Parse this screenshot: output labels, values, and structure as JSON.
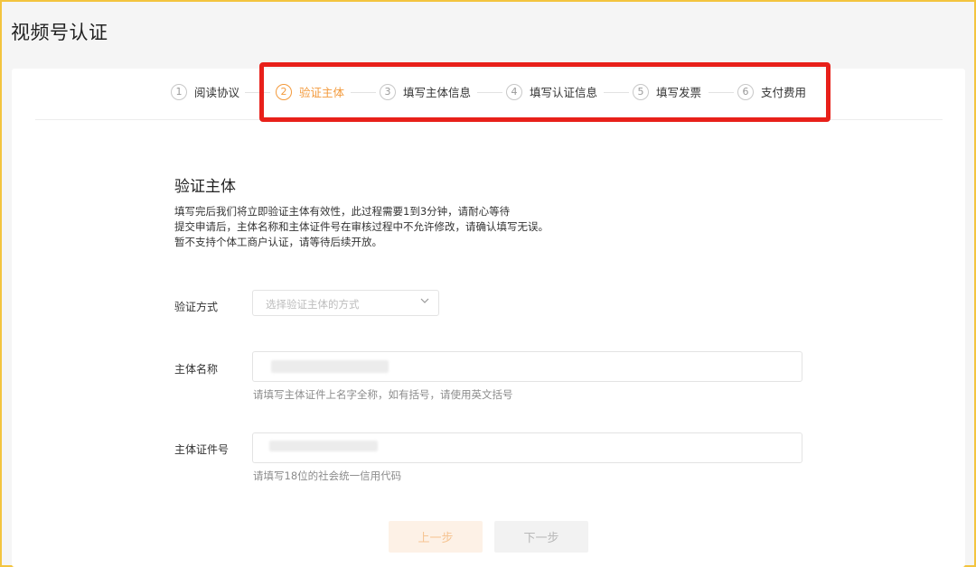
{
  "page": {
    "title": "视频号认证"
  },
  "steps": [
    {
      "num": "1",
      "label": "阅读协议",
      "state": "done"
    },
    {
      "num": "2",
      "label": "验证主体",
      "state": "active"
    },
    {
      "num": "3",
      "label": "填写主体信息",
      "state": "pending"
    },
    {
      "num": "4",
      "label": "填写认证信息",
      "state": "pending"
    },
    {
      "num": "5",
      "label": "填写发票",
      "state": "pending"
    },
    {
      "num": "6",
      "label": "支付费用",
      "state": "pending"
    }
  ],
  "section": {
    "title": "验证主体",
    "desc_lines": [
      "填写完后我们将立即验证主体有效性，此过程需要1到3分钟，请耐心等待",
      "提交申请后，主体名称和主体证件号在审核过程中不允许修改，请确认填写无误。",
      "暂不支持个体工商户认证，请等待后续开放。"
    ]
  },
  "form": {
    "method": {
      "label": "验证方式",
      "placeholder": "选择验证主体的方式",
      "value": ""
    },
    "name": {
      "label": "主体名称",
      "value": "",
      "hint": "请填写主体证件上名字全称，如有括号，请使用英文括号"
    },
    "id_number": {
      "label": "主体证件号",
      "value": "",
      "hint": "请填写18位的社会统一信用代码"
    }
  },
  "buttons": {
    "prev": "上一步",
    "next": "下一步"
  },
  "colors": {
    "accent": "#f39a3c",
    "highlight": "#e8201a",
    "frame": "#f3c43f"
  }
}
